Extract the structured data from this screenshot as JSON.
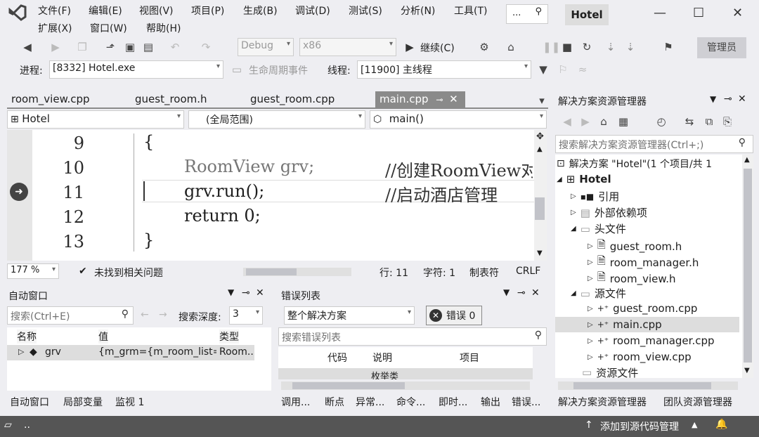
{
  "menu": {
    "row1": [
      "文件(F)",
      "编辑(E)",
      "视图(V)",
      "项目(P)",
      "生成(B)",
      "调试(D)",
      "测试(S)",
      "分析(N)",
      "工具(T)"
    ],
    "row2": [
      "扩展(X)",
      "窗口(W)",
      "帮助(H)"
    ]
  },
  "search": {
    "value": "..."
  },
  "solution_name": "Hotel",
  "toolbar": {
    "config": "Debug",
    "platform": "x86",
    "continue": "继续(C)",
    "admin": "管理员"
  },
  "debug_bar": {
    "process_label": "进程:",
    "process_value": "[8332] Hotel.exe",
    "lifecycle": "生命周期事件",
    "thread_label": "线程:",
    "thread_value": "[11900] 主线程"
  },
  "tabs": [
    {
      "label": "room_view.cpp"
    },
    {
      "label": "guest_room.h"
    },
    {
      "label": "guest_room.cpp"
    },
    {
      "label": "main.cpp"
    }
  ],
  "nav": {
    "project": "Hotel",
    "scope": "(全局范围)",
    "member": "main()"
  },
  "code": {
    "lines": [
      {
        "num": "9",
        "text": "{"
      },
      {
        "num": "10",
        "text": "RoomView grv;",
        "comment": "//创建RoomView对象"
      },
      {
        "num": "11",
        "text": "grv.run();",
        "comment": "//启动酒店管理"
      },
      {
        "num": "12",
        "text": "return 0;"
      },
      {
        "num": "13",
        "text": "}"
      }
    ]
  },
  "editor_status": {
    "zoom": "177 %",
    "issues": "未找到相关问题",
    "line": "行: 11",
    "char": "字符: 1",
    "tab": "制表符",
    "eol": "CRLF"
  },
  "autos": {
    "title": "自动窗口",
    "search_placeholder": "搜索(Ctrl+E)",
    "depth_label": "搜索深度:",
    "depth_value": "3",
    "columns": [
      "名称",
      "值",
      "类型"
    ],
    "rows": [
      {
        "name": "grv",
        "value": "{m_grm={m_room_list=...",
        "type": "Room..."
      }
    ]
  },
  "errors": {
    "title": "错误列表",
    "scope": "整个解决方案",
    "error_count": "错误 0",
    "search_placeholder": "搜索错误列表",
    "columns": [
      "代码",
      "说明",
      "项目"
    ],
    "group_row": "枚举类"
  },
  "solution_explorer": {
    "title": "解决方案资源管理器",
    "search_placeholder": "搜索解决方案资源管理器(Ctrl+;)",
    "root": "解决方案 \"Hotel\"(1 个项目/共 1",
    "project": "Hotel",
    "items": [
      {
        "label": "引用"
      },
      {
        "label": "外部依赖项"
      },
      {
        "label": "头文件"
      },
      {
        "label": "guest_room.h"
      },
      {
        "label": "room_manager.h"
      },
      {
        "label": "room_view.h"
      },
      {
        "label": "源文件"
      },
      {
        "label": "guest_room.cpp"
      },
      {
        "label": "main.cpp"
      },
      {
        "label": "room_manager.cpp"
      },
      {
        "label": "room_view.cpp"
      },
      {
        "label": "资源文件"
      }
    ]
  },
  "bottom_tabs_left": [
    "自动窗口",
    "局部变量",
    "监视 1"
  ],
  "bottom_tabs_mid": [
    "调用...",
    "断点",
    "异常...",
    "命令...",
    "即时...",
    "输出",
    "错误..."
  ],
  "bottom_tabs_right": [
    "解决方案资源管理器",
    "团队资源管理器"
  ],
  "statusbar": {
    "left": "..",
    "source_control": "添加到源代码管理"
  }
}
